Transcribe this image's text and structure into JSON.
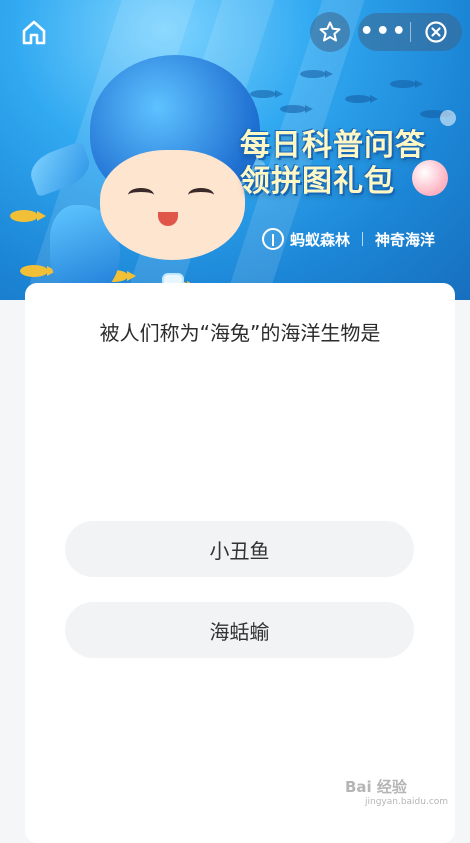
{
  "banner": {
    "title_line1": "每日科普问答",
    "title_line2": "领拼图礼包",
    "brand_left": "蚂蚁森林",
    "brand_right": "神奇海洋"
  },
  "nav": {
    "home_icon": "home-icon",
    "favorite_icon": "star-icon",
    "more_icon": "more-dots-icon",
    "close_icon": "close-circle-icon",
    "more_label": "•••"
  },
  "quiz": {
    "question": "被人们称为“海兔”的海洋生物是",
    "options": [
      "小丑鱼",
      "海蛞蝓"
    ]
  },
  "watermark": {
    "text": "Bai 经验",
    "sub": "jingyan.baidu.com"
  },
  "colors": {
    "banner_blue": "#1c86d6",
    "title_yellow": "#fff7c4",
    "option_bg": "#f2f3f5",
    "page_bg": "#f5f6f8"
  }
}
